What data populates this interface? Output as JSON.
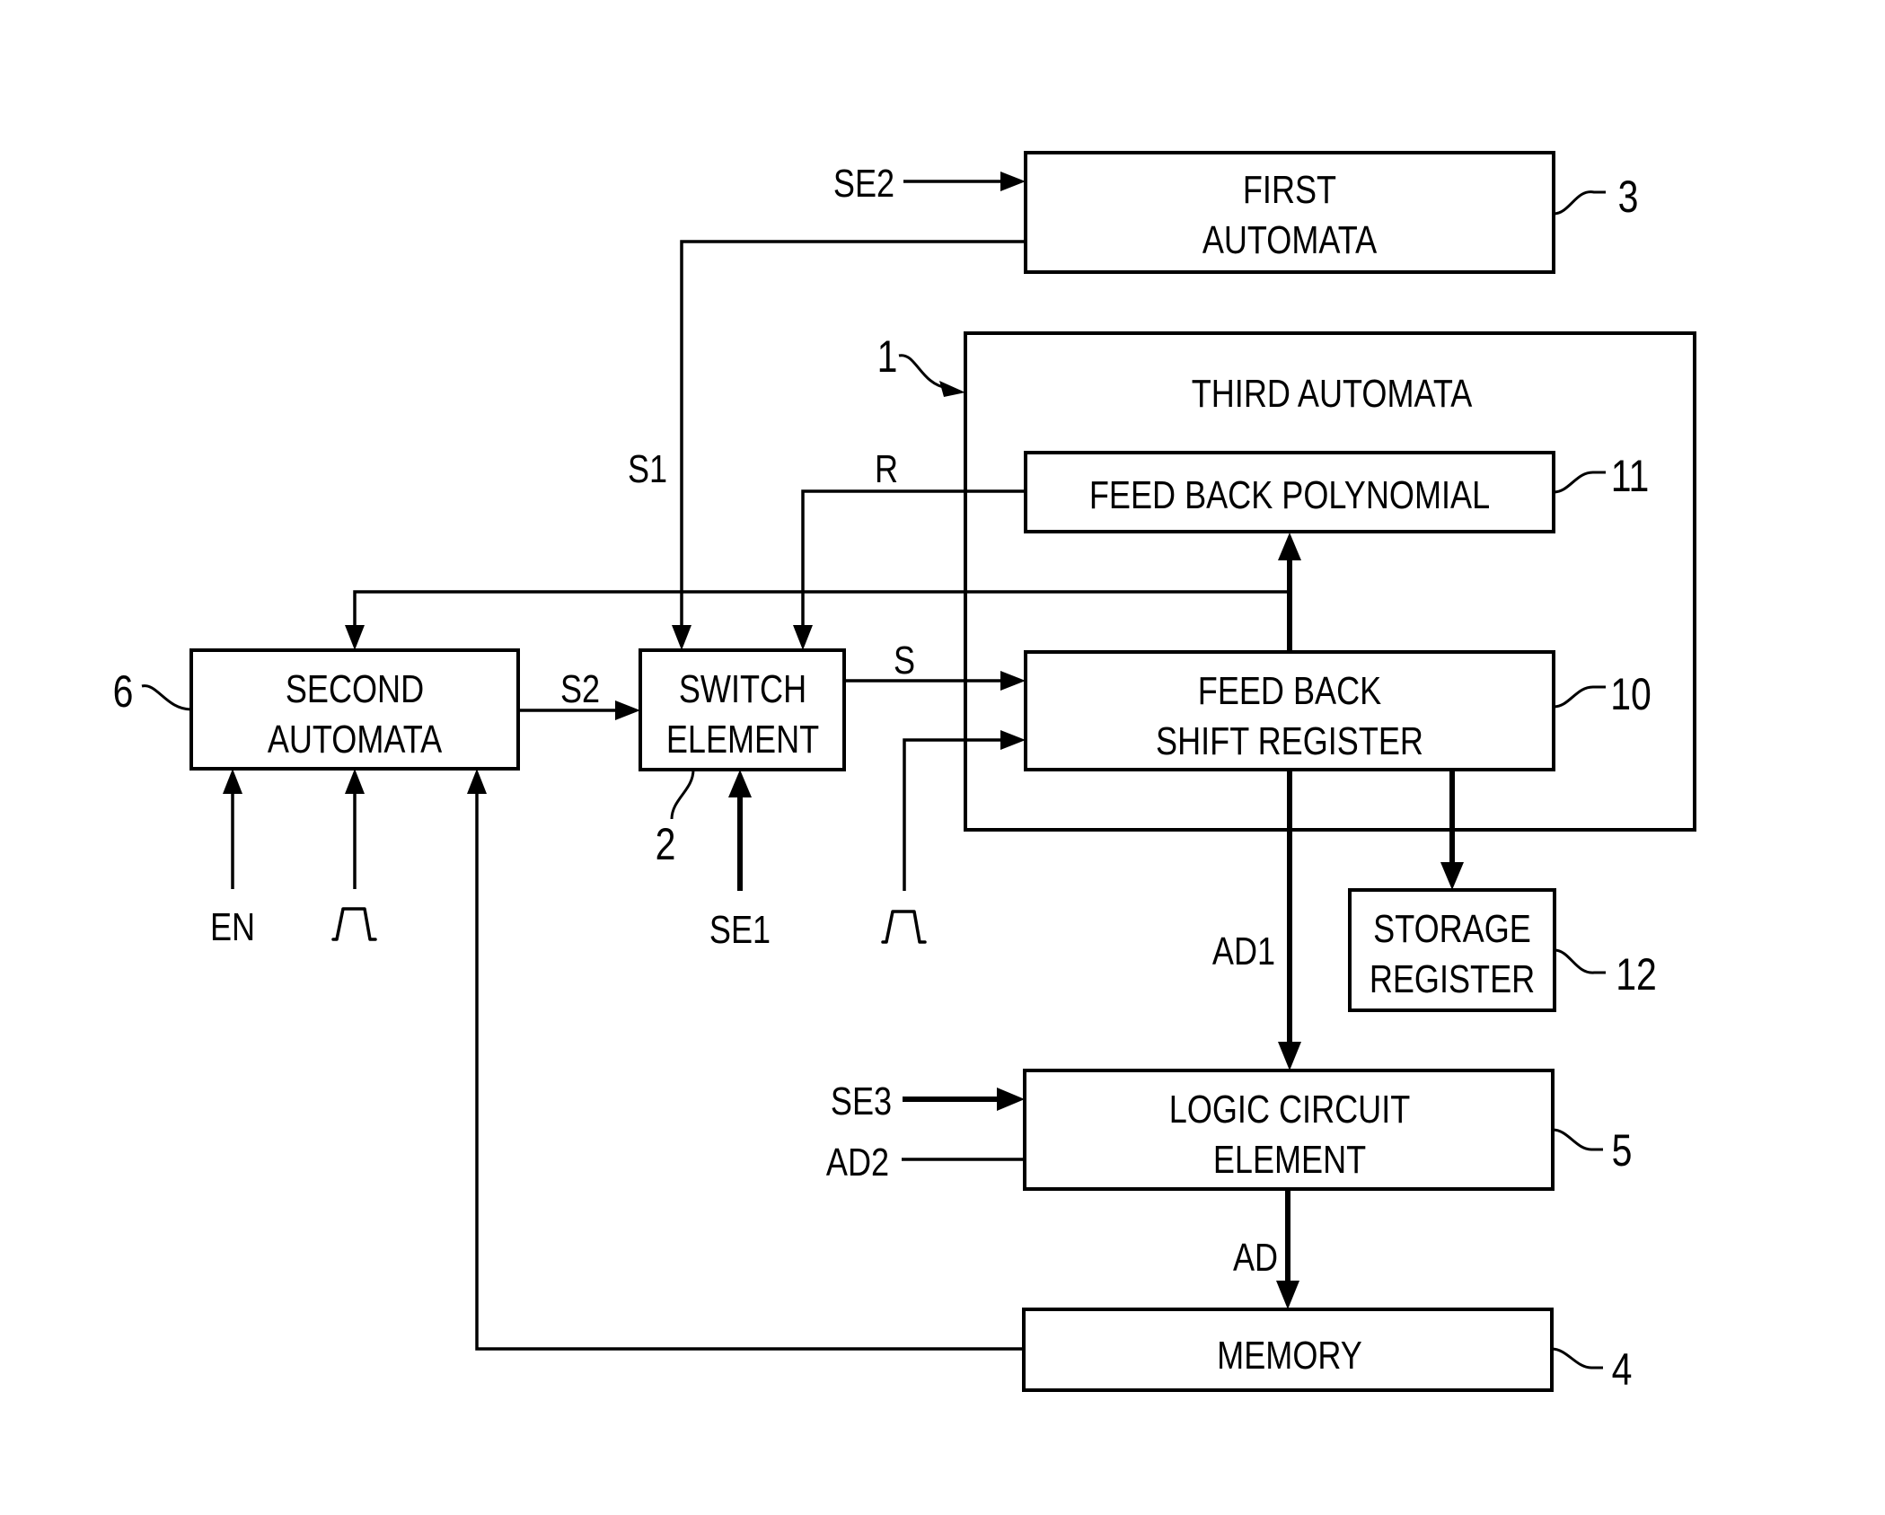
{
  "figure": {
    "blocks": {
      "first_automata": {
        "line1": "FIRST",
        "line2": "AUTOMATA",
        "ref": "3"
      },
      "third_automata": {
        "title": "THIRD AUTOMATA",
        "ref": "1"
      },
      "feedback_polynomial": {
        "label": "FEED BACK POLYNOMIAL",
        "ref": "11"
      },
      "feedback_shift_register": {
        "line1": "FEED BACK",
        "line2": "SHIFT REGISTER",
        "ref": "10"
      },
      "storage_register": {
        "line1": "STORAGE",
        "line2": "REGISTER",
        "ref": "12"
      },
      "second_automata": {
        "line1": "SECOND",
        "line2": "AUTOMATA",
        "ref": "6"
      },
      "switch_element": {
        "line1": "SWITCH",
        "line2": "ELEMENT",
        "ref": "2"
      },
      "logic_circuit_element": {
        "line1": "LOGIC CIRCUIT",
        "line2": "ELEMENT",
        "ref": "5"
      },
      "memory": {
        "label": "MEMORY",
        "ref": "4"
      }
    },
    "signals": {
      "se2": "SE2",
      "s1": "S1",
      "r": "R",
      "s": "S",
      "s2": "S2",
      "en": "EN",
      "se1": "SE1",
      "ad1": "AD1",
      "se3": "SE3",
      "ad2": "AD2",
      "ad": "AD"
    },
    "clock_symbols": [
      "clock-pulse",
      "clock-pulse"
    ]
  }
}
